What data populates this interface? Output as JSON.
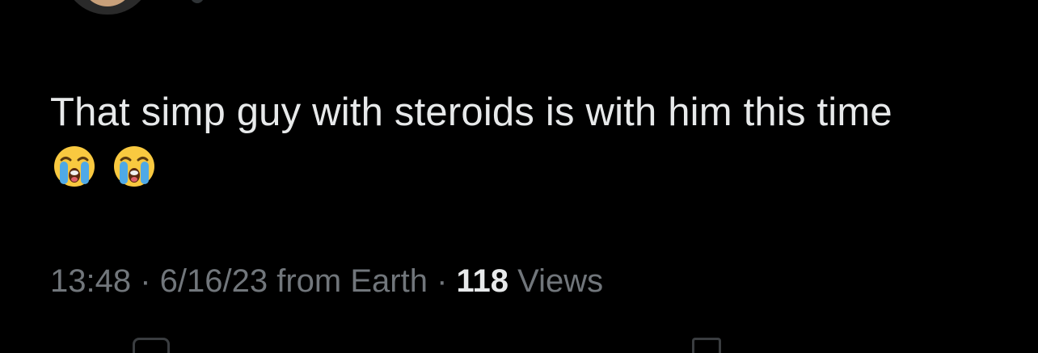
{
  "tweet": {
    "text": "That simp guy with steroids is with him this time",
    "emojis": [
      "loudly-crying-face-icon",
      "loudly-crying-face-icon"
    ]
  },
  "meta": {
    "time": "13:48",
    "separator1": " · ",
    "date": "6/16/23",
    "source": " from Earth",
    "separator2": " · ",
    "views_count": "118",
    "views_label": " Views"
  },
  "colors": {
    "background": "#000000",
    "text_primary": "#e7e9ea",
    "text_secondary": "#71767b"
  }
}
